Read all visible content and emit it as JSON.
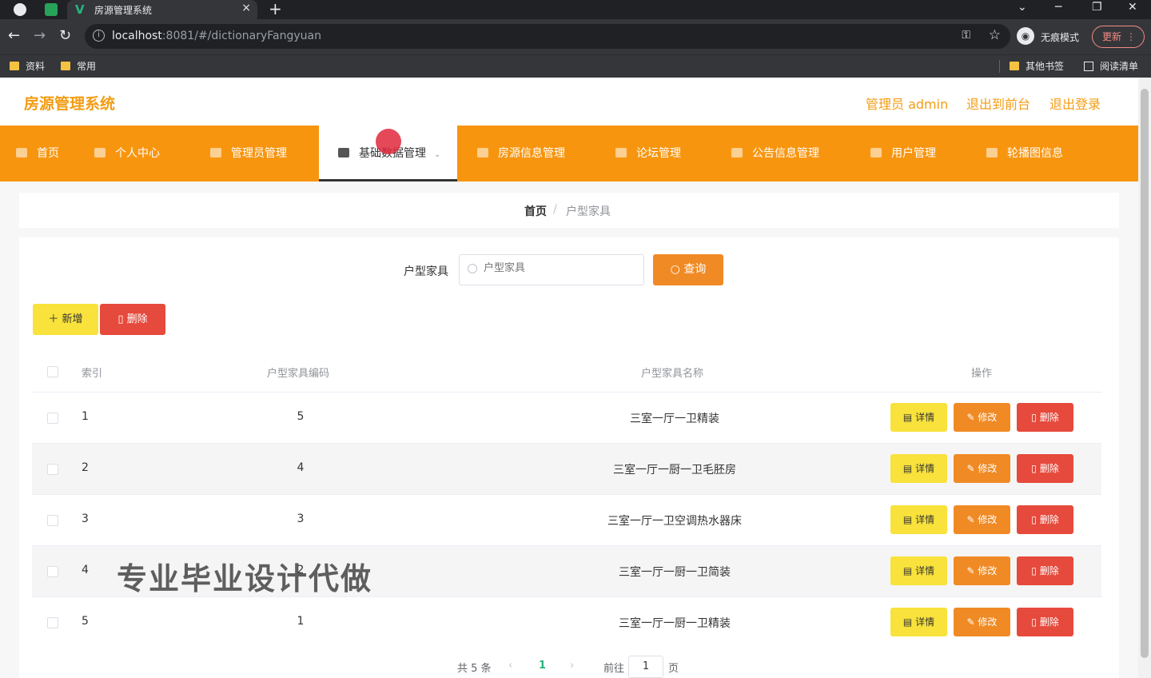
{
  "browser": {
    "tab_title": "房源管理系统",
    "tab_close": "×",
    "new_tab": "+",
    "url_host": "localhost",
    "url_rest": ":8081/#/dictionaryFangyuan",
    "incognito_label": "无痕模式",
    "update_label": "更新",
    "bookmarks": [
      "资料",
      "常用"
    ],
    "bookmarks_right": [
      "其他书签",
      "阅读清单"
    ]
  },
  "app": {
    "title": "房源管理系统",
    "header_links": [
      "管理员 admin",
      "退出到前台",
      "退出登录"
    ],
    "nav": [
      {
        "label": "首页"
      },
      {
        "label": "个人中心"
      },
      {
        "label": "管理员管理"
      },
      {
        "label": "基础数据管理",
        "active": true
      },
      {
        "label": "房源信息管理"
      },
      {
        "label": "论坛管理"
      },
      {
        "label": "公告信息管理"
      },
      {
        "label": "用户管理"
      },
      {
        "label": "轮播图信息"
      }
    ],
    "breadcrumb": {
      "home": "首页",
      "sep": "/",
      "current": "户型家具"
    }
  },
  "search": {
    "label": "户型家具",
    "placeholder": "户型家具",
    "button": "查询"
  },
  "actions": {
    "add": "＋ 新增",
    "delete": "删除"
  },
  "table": {
    "columns": [
      "索引",
      "户型家具编码",
      "户型家具名称",
      "操作"
    ],
    "rows": [
      {
        "index": "1",
        "code": "5",
        "name": "三室一厅一卫精装"
      },
      {
        "index": "2",
        "code": "4",
        "name": "三室一厅一厨一卫毛胚房"
      },
      {
        "index": "3",
        "code": "3",
        "name": "三室一厅一卫空调热水器床"
      },
      {
        "index": "4",
        "code": "2",
        "name": "三室一厅一厨一卫简装"
      },
      {
        "index": "5",
        "code": "1",
        "name": "三室一厅一厨一卫精装"
      }
    ],
    "row_ops": {
      "detail": "详情",
      "edit": "修改",
      "remove": "删除"
    }
  },
  "watermark": "专业毕业设计代做",
  "pagination": {
    "total": "共 5 条",
    "prev": "‹",
    "current": "1",
    "next": "›",
    "goto_label": "前往",
    "goto_value": "1",
    "page_suffix": "页"
  }
}
